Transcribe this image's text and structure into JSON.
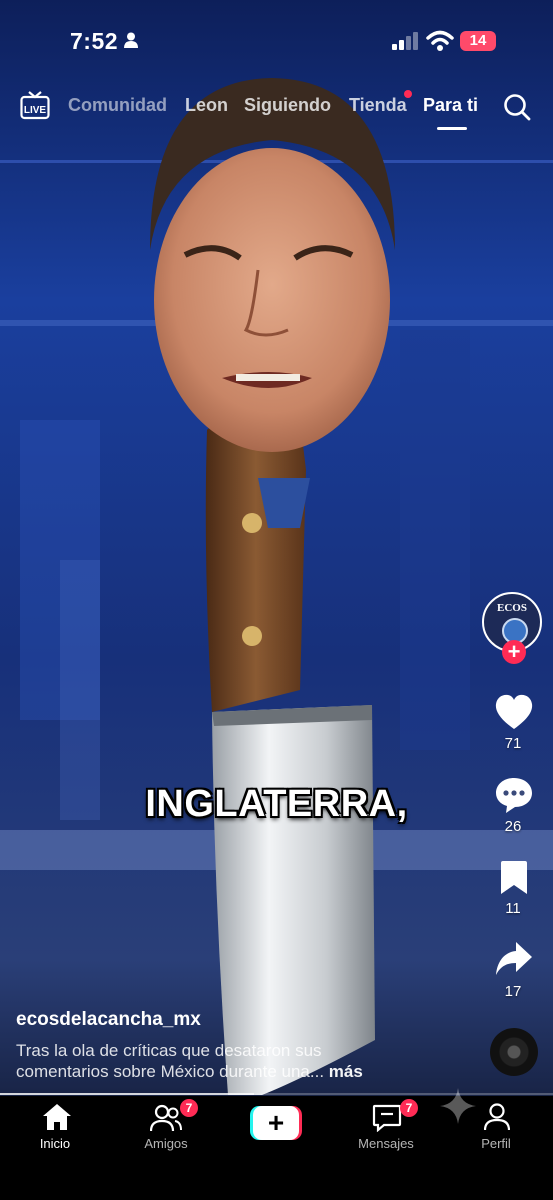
{
  "status_bar": {
    "time": "7:52",
    "battery": "14"
  },
  "top_nav": {
    "live_label": "LIVE",
    "tabs": [
      {
        "label": "Comunidad"
      },
      {
        "label": "Leon"
      },
      {
        "label": "Siguiendo"
      },
      {
        "label": "Tienda"
      },
      {
        "label": "Para ti"
      }
    ],
    "active_tab": "Para ti"
  },
  "video": {
    "caption": "INGLATERRA,",
    "progress": 0.46
  },
  "right_rail": {
    "avatar_text": "ECOS",
    "likes": "71",
    "comments": "26",
    "saves": "11",
    "shares": "17"
  },
  "description": {
    "username": "ecosdelacancha_mx",
    "line1": "Tras la ola de críticas que desataron sus",
    "line2": "comentarios sobre México durante una...",
    "more": "más"
  },
  "bottom_nav": {
    "items": [
      {
        "label": "Inicio"
      },
      {
        "label": "Amigos",
        "badge": "7"
      },
      {
        "label": "+"
      },
      {
        "label": "Mensajes",
        "badge": "7"
      },
      {
        "label": "Perfil"
      }
    ]
  },
  "colors": {
    "accent": "#ff2b55",
    "studio_blue": "#1b3d8f",
    "background": "#000000"
  }
}
